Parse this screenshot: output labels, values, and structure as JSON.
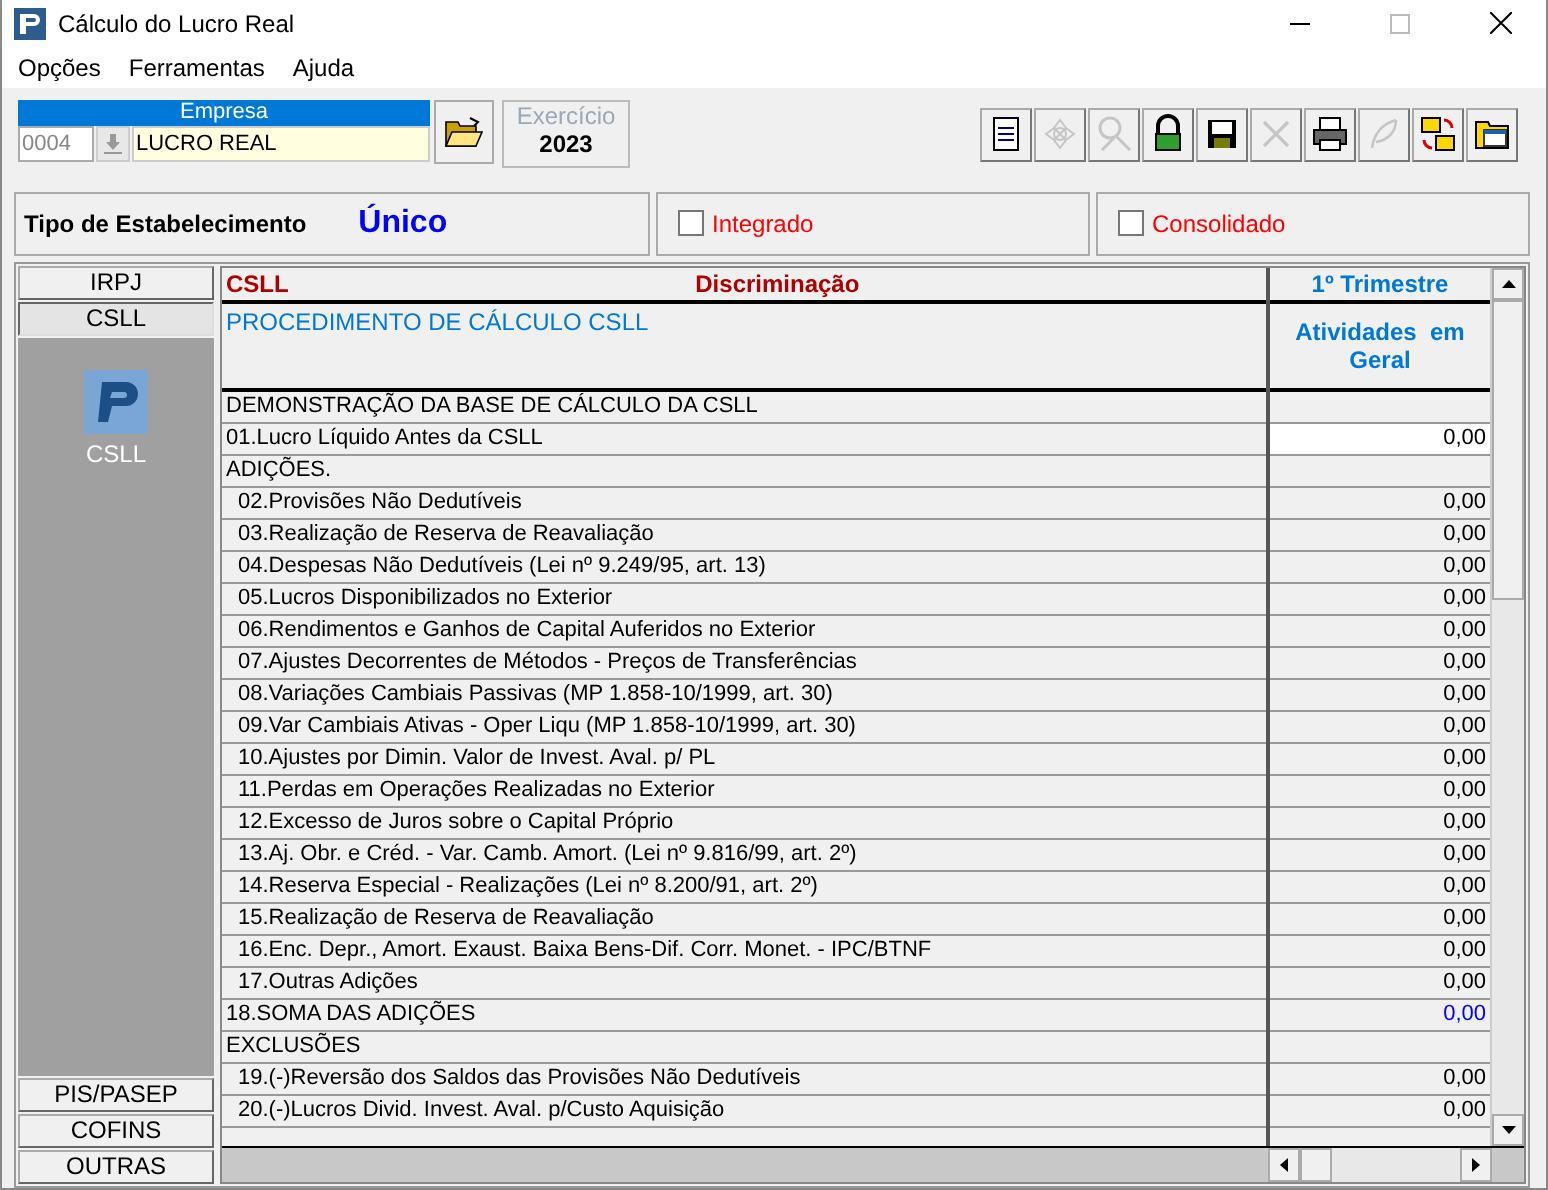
{
  "window": {
    "title": "Cálculo do Lucro Real"
  },
  "menu": [
    "Opções",
    "Ferramentas",
    "Ajuda"
  ],
  "empresa": {
    "label": "Empresa",
    "code": "0004",
    "name": "LUCRO REAL"
  },
  "exercicio": {
    "label": "Exercício",
    "value": "2023"
  },
  "toolbar": [
    {
      "kind": "document",
      "disabled": false
    },
    {
      "kind": "flower",
      "disabled": true
    },
    {
      "kind": "search",
      "disabled": true
    },
    {
      "kind": "lock",
      "disabled": false
    },
    {
      "kind": "save",
      "disabled": false
    },
    {
      "kind": "delete",
      "disabled": true
    },
    {
      "kind": "printer",
      "disabled": false
    },
    {
      "kind": "feather",
      "disabled": true
    },
    {
      "kind": "swap",
      "disabled": false
    },
    {
      "kind": "folder",
      "disabled": false
    }
  ],
  "establishment": {
    "label": "Tipo de Estabelecimento",
    "value": "Único"
  },
  "options": [
    {
      "label": "Integrado",
      "checked": false
    },
    {
      "label": "Consolidado",
      "checked": false
    }
  ],
  "sidebar": [
    {
      "label": "IRPJ",
      "selected": false
    },
    {
      "label": "CSLL",
      "selected": true,
      "panel_label": "CSLL"
    },
    {
      "label": "PIS/PASEP",
      "selected": false
    },
    {
      "label": "COFINS",
      "selected": false
    },
    {
      "label": "OUTRAS",
      "selected": false
    }
  ],
  "table": {
    "code": "CSLL",
    "column_header": "Discriminação",
    "period": "1º Trimestre",
    "procedure": "PROCEDIMENTO DE CÁLCULO CSLL",
    "activity": "Atividades  em Geral",
    "rows": [
      {
        "kind": "section",
        "label": "DEMONSTRAÇÃO DA BASE DE CÁLCULO DA CSLL"
      },
      {
        "kind": "input",
        "label": "01.Lucro Líquido Antes da CSLL",
        "value": "0,00"
      },
      {
        "kind": "section",
        "label": "ADIÇÕES."
      },
      {
        "kind": "item",
        "label": "02.Provisões Não Dedutíveis",
        "value": "0,00"
      },
      {
        "kind": "item",
        "label": "03.Realização de Reserva de Reavaliação",
        "value": "0,00"
      },
      {
        "kind": "item",
        "label": "04.Despesas Não Dedutíveis (Lei nº 9.249/95, art. 13)",
        "value": "0,00"
      },
      {
        "kind": "item",
        "label": "05.Lucros Disponibilizados no Exterior",
        "value": "0,00"
      },
      {
        "kind": "item",
        "label": "06.Rendimentos e Ganhos de Capital Auferidos no Exterior",
        "value": "0,00"
      },
      {
        "kind": "item",
        "label": "07.Ajustes Decorrentes de Métodos - Preços de Transferências",
        "value": "0,00"
      },
      {
        "kind": "item",
        "label": "08.Variações Cambiais Passivas (MP 1.858-10/1999, art. 30)",
        "value": "0,00"
      },
      {
        "kind": "item",
        "label": "09.Var Cambiais Ativas - Oper Liqu (MP 1.858-10/1999, art. 30)",
        "value": "0,00"
      },
      {
        "kind": "item",
        "label": "10.Ajustes por Dimin. Valor de Invest. Aval. p/ PL",
        "value": "0,00"
      },
      {
        "kind": "item",
        "label": "11.Perdas em Operações Realizadas no Exterior",
        "value": "0,00"
      },
      {
        "kind": "item",
        "label": "12.Excesso de Juros sobre o Capital Próprio",
        "value": "0,00"
      },
      {
        "kind": "item",
        "label": "13.Aj. Obr. e Créd. - Var. Camb. Amort. (Lei nº 9.816/99, art. 2º)",
        "value": "0,00"
      },
      {
        "kind": "item",
        "label": "14.Reserva Especial - Realizações (Lei nº 8.200/91, art. 2º)",
        "value": "0,00"
      },
      {
        "kind": "item",
        "label": "15.Realização de Reserva de Reavaliação",
        "value": "0,00"
      },
      {
        "kind": "item",
        "label": "16.Enc. Depr., Amort. Exaust. Baixa Bens-Dif. Corr. Monet. - IPC/BTNF",
        "value": "0,00"
      },
      {
        "kind": "item",
        "label": "17.Outras Adições",
        "value": "0,00"
      },
      {
        "kind": "total",
        "label": "18.SOMA DAS ADIÇÕES",
        "value": "0,00"
      },
      {
        "kind": "section",
        "label": "EXCLUSÕES"
      },
      {
        "kind": "item",
        "label": "19.(-)Reversão dos Saldos das Provisões Não Dedutíveis",
        "value": "0,00"
      },
      {
        "kind": "item",
        "label": "20.(-)Lucros Divid. Invest. Aval. p/Custo Aquisição",
        "value": "0,00"
      }
    ]
  }
}
